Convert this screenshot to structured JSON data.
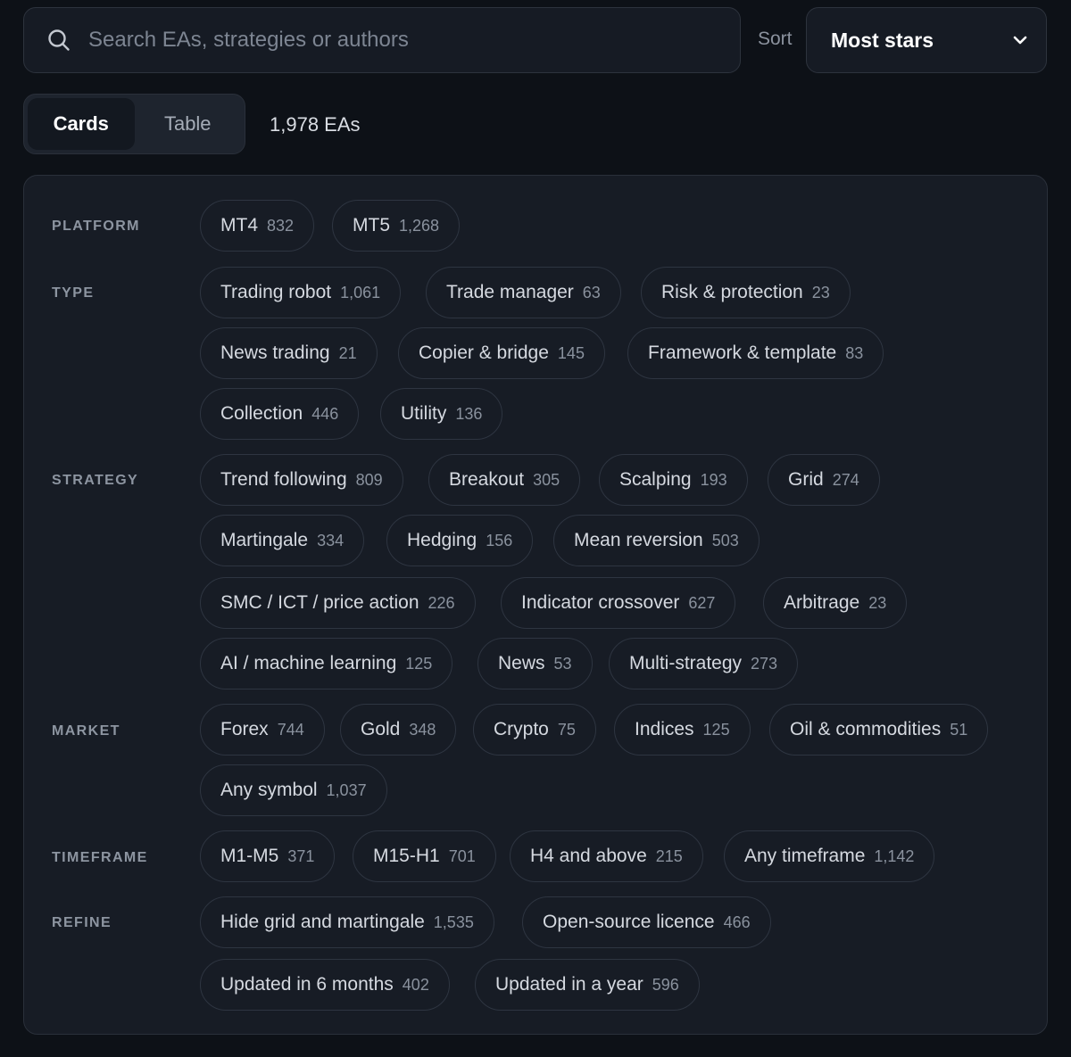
{
  "search": {
    "placeholder": "Search EAs, strategies or authors",
    "icon": "search-icon"
  },
  "sort": {
    "label": "Sort",
    "selected": "Most stars",
    "icon": "chevron-down-icon"
  },
  "view": {
    "cards_label": "Cards",
    "table_label": "Table",
    "active": "Cards"
  },
  "result_count": "1,978 EAs",
  "filters": {
    "platform": {
      "label": "PLATFORM",
      "chips": [
        {
          "label": "MT4",
          "count": "832"
        },
        {
          "label": "MT5",
          "count": "1,268"
        }
      ]
    },
    "type": {
      "label": "TYPE",
      "chips": [
        {
          "label": "Trading robot",
          "count": "1,061"
        },
        {
          "label": "Trade manager",
          "count": "63"
        },
        {
          "label": "Risk & protection",
          "count": "23"
        },
        {
          "label": "News trading",
          "count": "21"
        },
        {
          "label": "Copier & bridge",
          "count": "145"
        },
        {
          "label": "Framework & template",
          "count": "83"
        },
        {
          "label": "Collection",
          "count": "446"
        },
        {
          "label": "Utility",
          "count": "136"
        }
      ]
    },
    "strategy": {
      "label": "STRATEGY",
      "chips": [
        {
          "label": "Trend following",
          "count": "809"
        },
        {
          "label": "Breakout",
          "count": "305"
        },
        {
          "label": "Scalping",
          "count": "193"
        },
        {
          "label": "Grid",
          "count": "274"
        },
        {
          "label": "Martingale",
          "count": "334"
        },
        {
          "label": "Hedging",
          "count": "156"
        },
        {
          "label": "Mean reversion",
          "count": "503"
        },
        {
          "label": "SMC / ICT / price action",
          "count": "226"
        },
        {
          "label": "Indicator crossover",
          "count": "627"
        },
        {
          "label": "Arbitrage",
          "count": "23"
        },
        {
          "label": "AI / machine learning",
          "count": "125"
        },
        {
          "label": "News",
          "count": "53"
        },
        {
          "label": "Multi-strategy",
          "count": "273"
        }
      ]
    },
    "market": {
      "label": "MARKET",
      "chips": [
        {
          "label": "Forex",
          "count": "744"
        },
        {
          "label": "Gold",
          "count": "348"
        },
        {
          "label": "Crypto",
          "count": "75"
        },
        {
          "label": "Indices",
          "count": "125"
        },
        {
          "label": "Oil & commodities",
          "count": "51"
        },
        {
          "label": "Any symbol",
          "count": "1,037"
        }
      ]
    },
    "timeframe": {
      "label": "TIMEFRAME",
      "chips": [
        {
          "label": "M1-M5",
          "count": "371"
        },
        {
          "label": "M15-H1",
          "count": "701"
        },
        {
          "label": "H4 and above",
          "count": "215"
        },
        {
          "label": "Any timeframe",
          "count": "1,142"
        }
      ]
    },
    "refine": {
      "label": "REFINE",
      "chips": [
        {
          "label": "Hide grid and martingale",
          "count": "1,535"
        },
        {
          "label": "Open-source licence",
          "count": "466"
        },
        {
          "label": "Updated in 6 months",
          "count": "402"
        },
        {
          "label": "Updated in a year",
          "count": "596"
        }
      ]
    }
  }
}
